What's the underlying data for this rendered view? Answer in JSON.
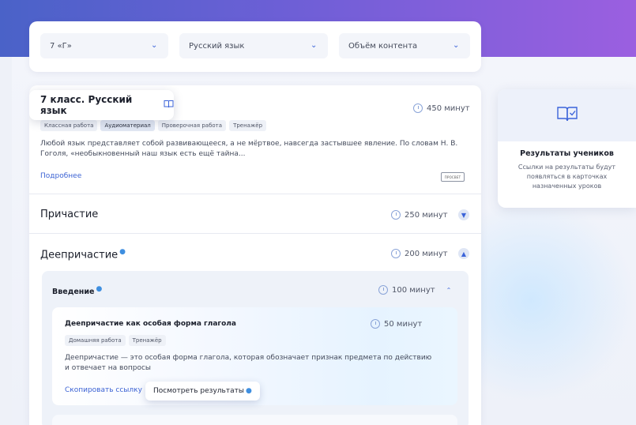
{
  "colors": {
    "accent": "#3b63d9",
    "header_start": "#4a62c8",
    "header_end": "#9b5fe0"
  },
  "filters": {
    "class_select": "7 «Г»",
    "subject_select": "Русский язык",
    "content_select": "Объём контента"
  },
  "course": {
    "title": "7 класс. Русский язык",
    "duration": "450 минут",
    "tags": [
      "Классная работа",
      "Аудиоматериал",
      "Проверочная работа",
      "Тренажёр"
    ],
    "active_tag": 1,
    "description": "Любой язык представляет собой развивающееся, а не мёртвое, навсегда застывшее явление. По словам Н. В. Гоголя, «необыкновенный наш язык есть ещё тайна...",
    "more_link": "Подробнее",
    "publisher_logo": "ПРОСВЕТ"
  },
  "sections": [
    {
      "title": "Причастие",
      "duration": "250 минут",
      "expanded": false
    },
    {
      "title": "Деепричастие",
      "duration": "200 минут",
      "expanded": true
    }
  ],
  "subsection": {
    "title": "Введение",
    "duration": "100 минут"
  },
  "lesson": {
    "title": "Деепричастие как особая форма глагола",
    "duration": "50 минут",
    "tags": [
      "Домашняя работа",
      "Тренажёр"
    ],
    "description": "Деепричастие — это особая форма глагола, которая обозначает признак предмета по действию и отвечает на вопросы",
    "copy_link": "Скопировать ссылку",
    "view_results": "Посмотреть результаты"
  },
  "side_panel": {
    "icon": "book-check-icon",
    "title": "Результаты учеников",
    "text": "Ссылки на результаты будут появляться в карточках назначенных уроков"
  }
}
